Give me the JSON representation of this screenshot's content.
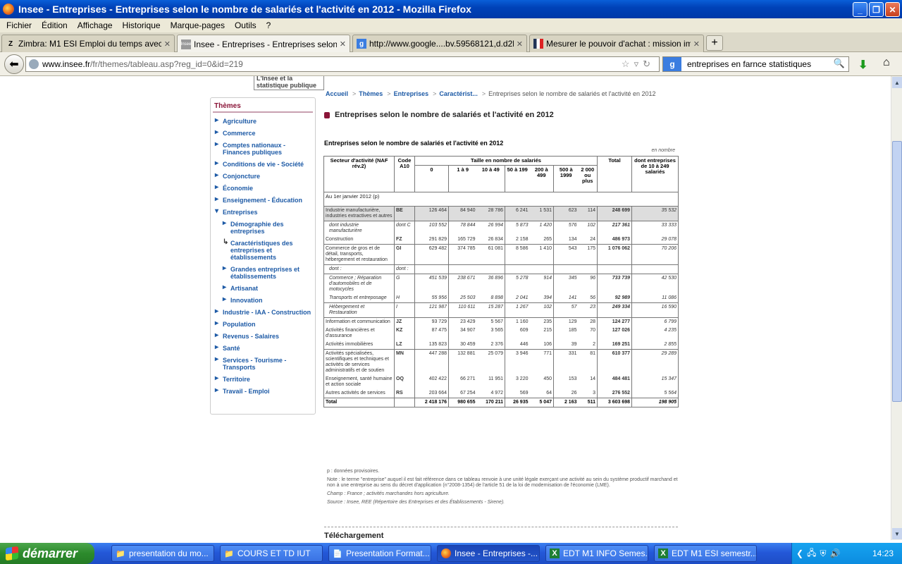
{
  "window": {
    "title": "Insee - Entreprises - Entreprises selon le nombre de salariés et l'activité en 2012 - Mozilla Firefox"
  },
  "menu": [
    "Fichier",
    "Édition",
    "Affichage",
    "Historique",
    "Marque-pages",
    "Outils",
    "?"
  ],
  "tabs": [
    {
      "label": "Zimbra: M1 ESI Emploi du temps avec salle"
    },
    {
      "label": "Insee - Entreprises - Entreprises selon le ..."
    },
    {
      "label": "http://www.google....bv.59568121,d.d2k"
    },
    {
      "label": "Mesurer le pouvoir d'achat : mission impo..."
    }
  ],
  "url": {
    "host": "www.insee.fr",
    "path": "/fr/themes/tableau.asp?reg_id=0&id=219"
  },
  "search": {
    "value": "entreprises en farnce statistiques"
  },
  "logo_tip": "L'Insee et la statistique publique",
  "sidebar": {
    "heading": "Thèmes",
    "items": [
      "Agriculture",
      "Commerce",
      "Comptes nationaux - Finances publiques",
      "Conditions de vie - Société",
      "Conjoncture",
      "Économie",
      "Enseignement - Éducation",
      "Entreprises"
    ],
    "sub": [
      "Démographie des entreprises",
      "Caractéristiques des entreprises et établissements",
      "Grandes entreprises et établissements",
      "Artisanat",
      "Innovation"
    ],
    "items2": [
      "Industrie - IAA - Construction",
      "Population",
      "Revenus - Salaires",
      "Santé",
      "Services - Tourisme - Transports",
      "Territoire",
      "Travail - Emploi"
    ]
  },
  "breadcrumb": {
    "b0": "Accueil",
    "b1": "Thèmes",
    "b2": "Entreprises",
    "b3": "Caractérist...",
    "current": "Entreprises selon le nombre de salariés et l'activité en 2012"
  },
  "page_title": "Entreprises selon le nombre de salariés et l'activité en 2012",
  "table": {
    "title": "Entreprises selon le nombre de salariés et l'activité en 2012",
    "unit": "en nombre",
    "h_sector": "Secteur d'activité (NAF rév.2)",
    "h_code": "Code A10",
    "h_size": "Taille en nombre de salariés",
    "h_total": "Total",
    "h_dont": "dont entreprises de 10 à 249 salariés",
    "sizes": [
      "0",
      "1 à 9",
      "10 à 49",
      "50 à 199",
      "200 à 499",
      "500 à 1999",
      "2 000 ou plus"
    ],
    "date_label": "Au 1er janvier 2012 (p)",
    "rows": [
      {
        "label": "Industrie manufacturière, industries extractives et autres",
        "code": "BE",
        "v": [
          "126 464",
          "84 940",
          "28 786",
          "6 241",
          "1 531",
          "623",
          "114"
        ],
        "total": "248 699",
        "dont": "35 532",
        "style": "gray"
      },
      {
        "label": "dont industrie manufacturière",
        "code": "dont C",
        "v": [
          "103 552",
          "78 844",
          "26 994",
          "5 873",
          "1 420",
          "576",
          "102"
        ],
        "total": "217 361",
        "dont": "33 333",
        "style": "it"
      },
      {
        "label": "Construction",
        "code": "FZ",
        "v": [
          "291 829",
          "165 729",
          "26 834",
          "2 158",
          "265",
          "134",
          "24"
        ],
        "total": "486 973",
        "dont": "29 078",
        "style": ""
      },
      {
        "label": "Commerce de gros et de détail, transports, hébergement et restauration",
        "code": "GI",
        "v": [
          "629 482",
          "374 785",
          "61 081",
          "8 586",
          "1 410",
          "543",
          "175"
        ],
        "total": "1 076 062",
        "dont": "70 206",
        "style": ""
      },
      {
        "label": "dont :",
        "code": "dont :",
        "v": [
          "",
          "",
          "",
          "",
          "",
          "",
          ""
        ],
        "total": "",
        "dont": "",
        "style": "it"
      },
      {
        "label": "Commerce ; Réparation d'automobiles et de motocycles",
        "code": "G",
        "v": [
          "451 539",
          "238 671",
          "36 896",
          "5 278",
          "914",
          "345",
          "96"
        ],
        "total": "733 739",
        "dont": "42 530",
        "style": "it"
      },
      {
        "label": "Transports et entreposage",
        "code": "H",
        "v": [
          "55 956",
          "25 503",
          "8 898",
          "2 041",
          "394",
          "141",
          "56"
        ],
        "total": "92 989",
        "dont": "11 086",
        "style": "it"
      },
      {
        "label": "Hébergement et Restauration",
        "code": "I",
        "v": [
          "121 987",
          "110 611",
          "15 287",
          "1 267",
          "102",
          "57",
          "23"
        ],
        "total": "249 334",
        "dont": "16 590",
        "style": "it"
      },
      {
        "label": "Information et communication",
        "code": "JZ",
        "v": [
          "93 729",
          "23 429",
          "5 567",
          "1 160",
          "235",
          "129",
          "28"
        ],
        "total": "124 277",
        "dont": "6 799",
        "style": ""
      },
      {
        "label": "Activités financières et d'assurance",
        "code": "KZ",
        "v": [
          "87 475",
          "34 907",
          "3 565",
          "609",
          "215",
          "185",
          "70"
        ],
        "total": "127 026",
        "dont": "4 235",
        "style": ""
      },
      {
        "label": "Activités immobilières",
        "code": "LZ",
        "v": [
          "135 823",
          "30 459",
          "2 376",
          "446",
          "106",
          "39",
          "2"
        ],
        "total": "169 251",
        "dont": "2 855",
        "style": ""
      },
      {
        "label": "Activités spécialisées, scientifiques et techniques et activités de services administratifs et de soutien",
        "code": "MN",
        "v": [
          "447 288",
          "132 881",
          "25 079",
          "3 946",
          "771",
          "331",
          "81"
        ],
        "total": "610 377",
        "dont": "29 289",
        "style": ""
      },
      {
        "label": "Enseignement, santé humaine et action sociale",
        "code": "OQ",
        "v": [
          "402 422",
          "66 271",
          "11 951",
          "3 220",
          "450",
          "153",
          "14"
        ],
        "total": "484 481",
        "dont": "15 347",
        "style": ""
      },
      {
        "label": "Autres activités de services",
        "code": "RS",
        "v": [
          "203 664",
          "67 254",
          "4 972",
          "569",
          "64",
          "26",
          "3"
        ],
        "total": "276 552",
        "dont": "5 564",
        "style": ""
      }
    ],
    "total_row": {
      "label": "Total",
      "v": [
        "2 418 176",
        "980 655",
        "170 211",
        "26 935",
        "5 047",
        "2 163",
        "511"
      ],
      "total": "3 603 698",
      "dont": "198 905"
    }
  },
  "notes": {
    "n1": "p : données provisoires.",
    "n2": "Note : le terme \"entreprise\" auquel il est fait référence dans ce tableau renvoie à une unité légale exerçant une activité au sein du système productif marchand et non à une entreprise au sens du décret d'application (n°2008-1354) de l'article 51 de la loi de modernisation de l'économie (LME).",
    "n3": "Champ : France ; activités marchandes hors agriculture.",
    "n4": "Source : Insee, REE (Répertoire des Entreprises et des Établissements - Sirene)."
  },
  "download": "Téléchargement",
  "taskbar": {
    "start": "démarrer",
    "items": [
      "presentation du mo...",
      "COURS ET TD IUT",
      "Presentation Format...",
      "Insee - Entreprises -...",
      "EDT M1 INFO Semes...",
      "EDT M1 ESI semestr..."
    ],
    "clock": "14:23"
  }
}
